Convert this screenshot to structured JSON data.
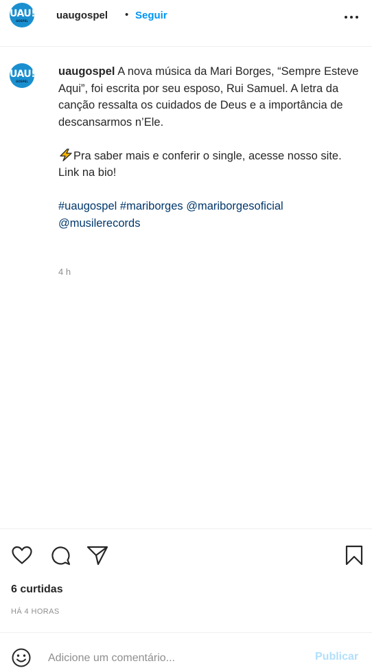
{
  "header": {
    "avatar_text": "UAU!",
    "avatar_subtext": "GOSPEL",
    "username": "uaugospel",
    "separator": "•",
    "follow_label": "Seguir"
  },
  "post": {
    "caption_username": "uaugospel",
    "caption_line1": "A nova música da Mari Borges, “Sempre Esteve Aqui”, foi escrita por seu esposo, Rui Samuel. A letra da canção ressalta os cuidados de Deus e a importância de descansarmos n’Ele.",
    "caption_line2": "Pra saber mais e conferir o single, acesse nosso site. Link na bio!",
    "hashtags": [
      "#uaugospel",
      "#mariborges",
      "@mariborgesoficial",
      "@musilerecords"
    ],
    "time_ago": "4 h"
  },
  "actions": {
    "likes_label": "6 curtidas",
    "timestamp": "HÁ 4 HORAS"
  },
  "comment_box": {
    "placeholder": "Adicione um comentário...",
    "publish_label": "Publicar"
  },
  "colors": {
    "accent": "#0095f6",
    "link": "#00376b",
    "muted": "#8e8e8e",
    "publish_disabled": "#b2dffc",
    "avatar_bg": "#1a8fd0"
  },
  "icons": [
    "more-icon",
    "lightning-icon",
    "heart-icon",
    "comment-icon",
    "share-icon",
    "bookmark-icon",
    "emoji-icon"
  ]
}
